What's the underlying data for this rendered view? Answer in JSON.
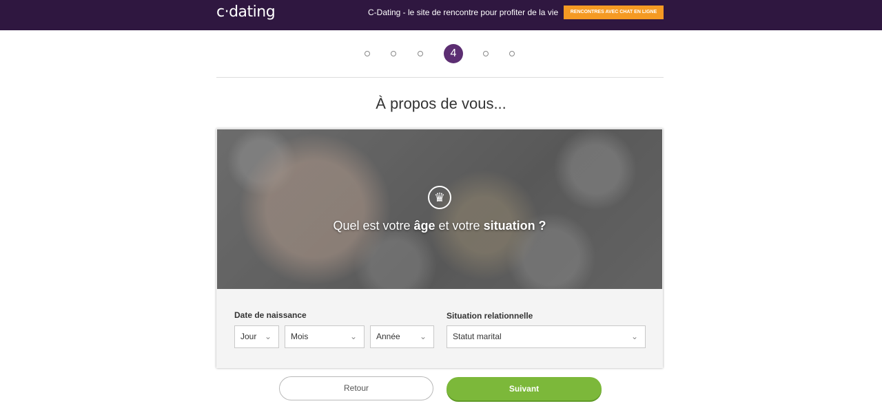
{
  "header": {
    "logo": "c·dating",
    "tagline": "C-Dating - le site de rencontre pour profiter de la vie",
    "cta_label": "RENCONTRES AVEC CHAT EN LIGNE",
    "bg_color": "#2f1740",
    "cta_color": "#f59a23"
  },
  "progress": {
    "current_step": "4",
    "total_steps": 6,
    "accent": "#5c2e72"
  },
  "page": {
    "title": "À propos de vous..."
  },
  "hero": {
    "icon": "crown-icon",
    "question_part1": "Quel est votre ",
    "question_bold1": "âge",
    "question_part2": " et votre ",
    "question_bold2": "situation ?"
  },
  "form": {
    "birth_label": "Date de naissance",
    "day_value": "Jour",
    "month_value": "Mois",
    "year_value": "Année",
    "relationship_label": "Situation relationnelle",
    "status_value": "Statut marital"
  },
  "buttons": {
    "back_label": "Retour",
    "next_label": "Suivant",
    "next_color": "#7cb83a"
  }
}
